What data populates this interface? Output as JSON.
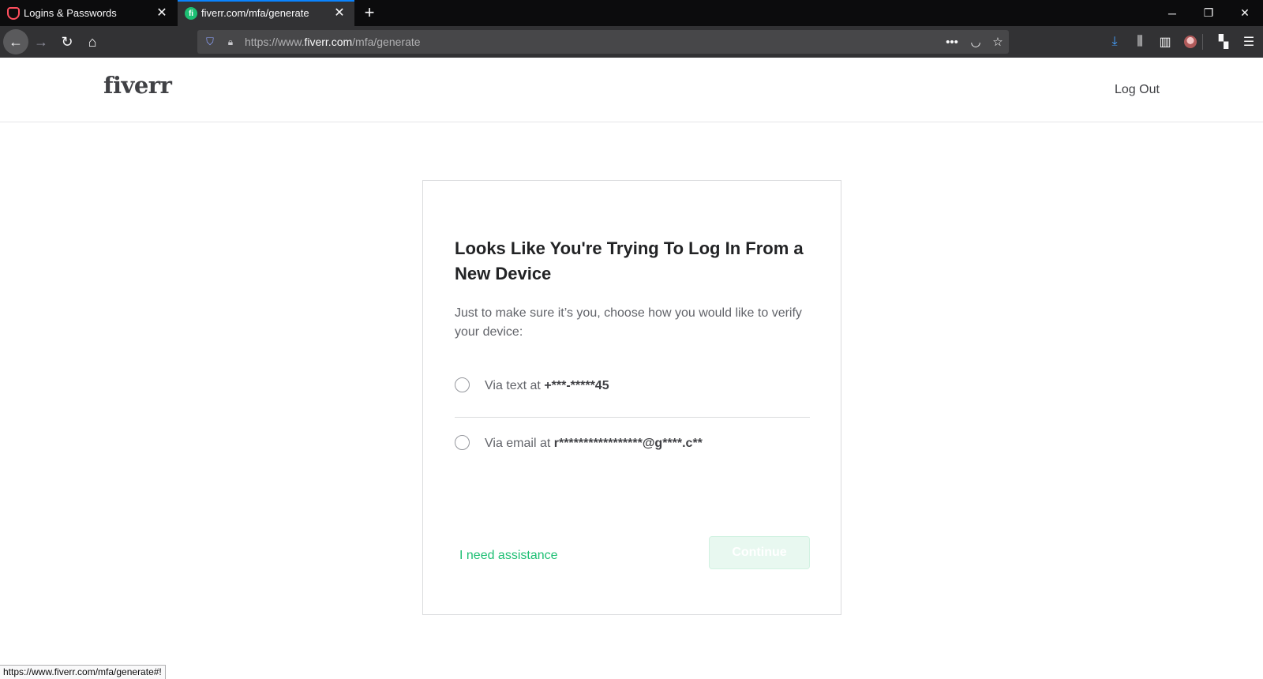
{
  "browser": {
    "tabs": [
      {
        "label": "Logins & Passwords",
        "icon": "lockwise-icon"
      },
      {
        "label": "fiverr.com/mfa/generate",
        "icon": "fiverr-favicon"
      }
    ],
    "url": {
      "prefix": "https://www.",
      "host": "fiverr.com",
      "path": "/mfa/generate"
    },
    "status_url": "https://www.fiverr.com/mfa/generate#!"
  },
  "site": {
    "logo": "fiverr",
    "logout_label": "Log Out"
  },
  "card": {
    "title": "Looks Like You're Trying To Log In From a New Device",
    "subtitle": "Just to make sure it’s you, choose how you would like to verify your device:",
    "options": [
      {
        "prefix": "Via text at ",
        "value": "+***-*****45",
        "selected": false
      },
      {
        "prefix": "Via email at ",
        "value": "r*****************@g****.c**",
        "selected": false
      }
    ],
    "assist_label": "I need assistance",
    "continue_label": "Continue"
  },
  "colors": {
    "accent": "#1dbf73",
    "tab_highlight": "#0a84ff"
  }
}
